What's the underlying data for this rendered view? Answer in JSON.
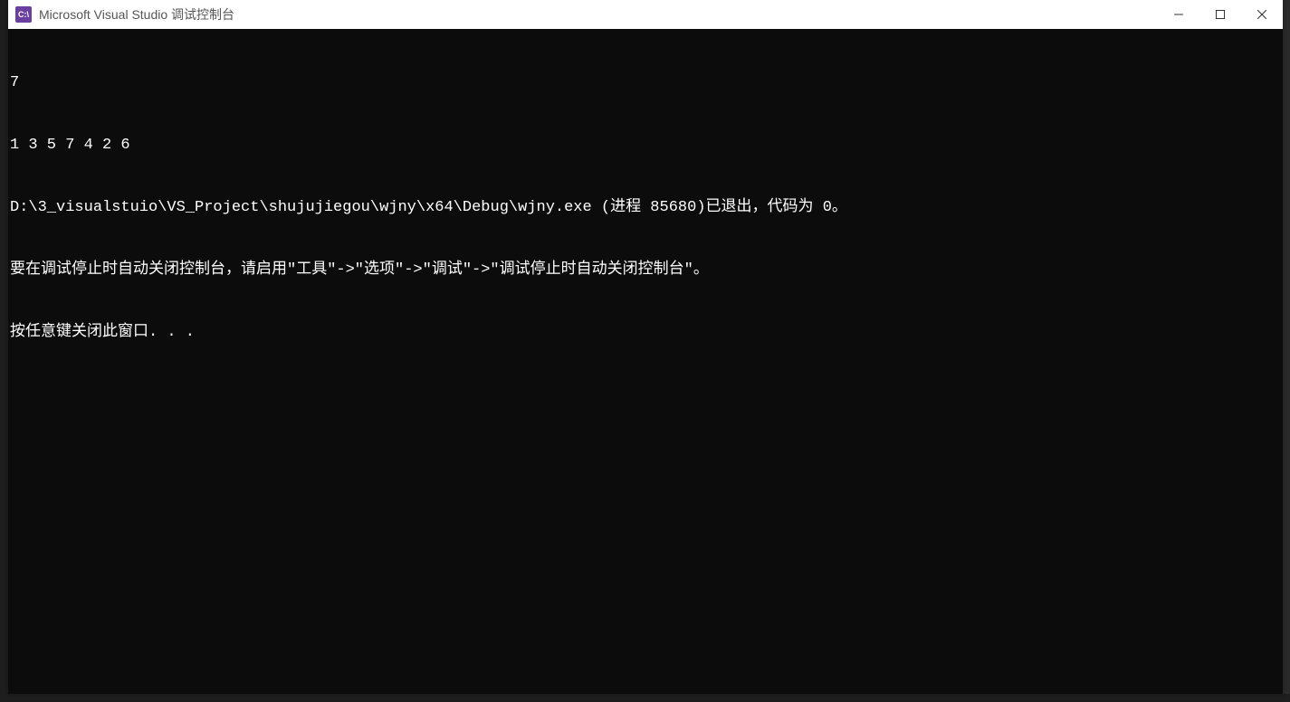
{
  "titlebar": {
    "icon_text": "C:\\",
    "title": "Microsoft Visual Studio 调试控制台"
  },
  "console": {
    "lines": [
      "7",
      "1 3 5 7 4 2 6",
      "D:\\3_visualstuio\\VS_Project\\shujujiegou\\wjny\\x64\\Debug\\wjny.exe (进程 85680)已退出，代码为 0。",
      "要在调试停止时自动关闭控制台，请启用\"工具\"->\"选项\"->\"调试\"->\"调试停止时自动关闭控制台\"。",
      "按任意键关闭此窗口. . ."
    ]
  }
}
